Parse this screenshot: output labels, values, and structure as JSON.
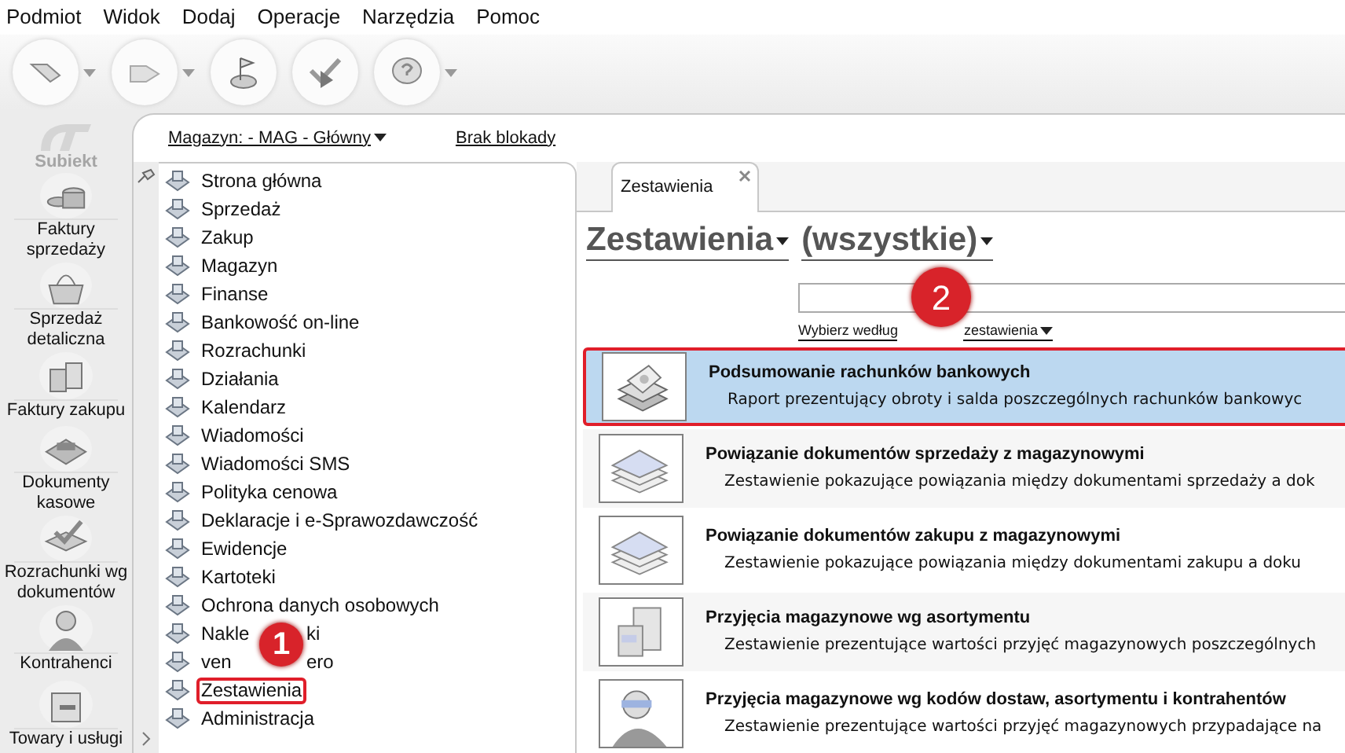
{
  "menu_bar": [
    "Podmiot",
    "Widok",
    "Dodaj",
    "Operacje",
    "Narzędzia",
    "Pomoc"
  ],
  "toolbar": [
    {
      "kind": "arrow-left",
      "dropdown": true
    },
    {
      "kind": "arrow-right",
      "dropdown": true
    },
    {
      "kind": "flag",
      "dropdown": false
    },
    {
      "kind": "check",
      "dropdown": false
    },
    {
      "kind": "help",
      "dropdown": true
    }
  ],
  "logo": {
    "text": "Subiekt"
  },
  "sidebar": [
    {
      "label": "Faktury sprzedaży",
      "kind": "coins"
    },
    {
      "label": "Sprzedaż detaliczna",
      "kind": "basket"
    },
    {
      "label": "Faktury zakupu",
      "kind": "boxes"
    },
    {
      "label": "Dokumenty kasowe",
      "kind": "register"
    },
    {
      "label": "Rozrachunki wg dokumentów",
      "kind": "check"
    },
    {
      "label": "Kontrahenci",
      "kind": "person"
    },
    {
      "label": "Towary i usługi",
      "kind": "box"
    }
  ],
  "nav_header": {
    "warehouse": "Magazyn: - MAG - Główny",
    "lock": "Brak blokady"
  },
  "nav_items": [
    {
      "label": "Strona główna",
      "selected": false
    },
    {
      "label": "Sprzedaż",
      "selected": false
    },
    {
      "label": "Zakup",
      "selected": false
    },
    {
      "label": "Magazyn",
      "selected": false
    },
    {
      "label": "Finanse",
      "selected": false
    },
    {
      "label": "Bankowość on-line",
      "selected": false
    },
    {
      "label": "Rozrachunki",
      "selected": false
    },
    {
      "label": "Działania",
      "selected": false
    },
    {
      "label": "Kalendarz",
      "selected": false
    },
    {
      "label": "Wiadomości",
      "selected": false
    },
    {
      "label": "Wiadomości SMS",
      "selected": false
    },
    {
      "label": "Polityka cenowa",
      "selected": false
    },
    {
      "label": "Deklaracje i e-Sprawozdawczość",
      "selected": false
    },
    {
      "label": "Ewidencje",
      "selected": false
    },
    {
      "label": "Kartoteki",
      "selected": false
    },
    {
      "label": "Ochrona danych osobowych",
      "selected": false
    },
    {
      "parts": [
        "Nakle",
        "ki"
      ],
      "selected": false
    },
    {
      "parts": [
        "ven",
        "ero"
      ],
      "selected": false
    },
    {
      "label": "Zestawienia",
      "selected": true
    },
    {
      "label": "Administracja",
      "selected": false
    }
  ],
  "tabs": [
    {
      "label": "Zestawienia",
      "selected": true
    }
  ],
  "heading": {
    "category": "Zestawienia",
    "filter": "(wszystkie)"
  },
  "search": {
    "mode_parts": [
      "Wybierz według",
      "zestawienia"
    ]
  },
  "reports": [
    {
      "title": "Podsumowanie rachunków bankowych",
      "description": "Raport prezentujący obroty i salda poszczególnych rachunków bankowyc",
      "kind": "money",
      "selected": true
    },
    {
      "title": "Powiązanie dokumentów sprzedaży z magazynowymi",
      "description": "Zestawienie pokazujące powiązania między dokumentami sprzedaży a dok",
      "kind": "papers",
      "selected": false
    },
    {
      "title": "Powiązanie dokumentów zakupu z magazynowymi",
      "description": "Zestawienie pokazujące powiązania między dokumentami zakupu a doku",
      "kind": "papers",
      "selected": false
    },
    {
      "title": "Przyjęcia magazynowe wg asortymentu",
      "description": "Zestawienie prezentujące wartości przyjęć magazynowych poszczególnych",
      "kind": "boxes",
      "selected": false
    },
    {
      "title": "Przyjęcia magazynowe wg kodów dostaw, asortymentu i kontrahentów",
      "description": "Zestawienie prezentujące wartości przyjęć magazynowych przypadające na",
      "kind": "person",
      "selected": false
    }
  ],
  "annotations": [
    "1",
    "2"
  ]
}
